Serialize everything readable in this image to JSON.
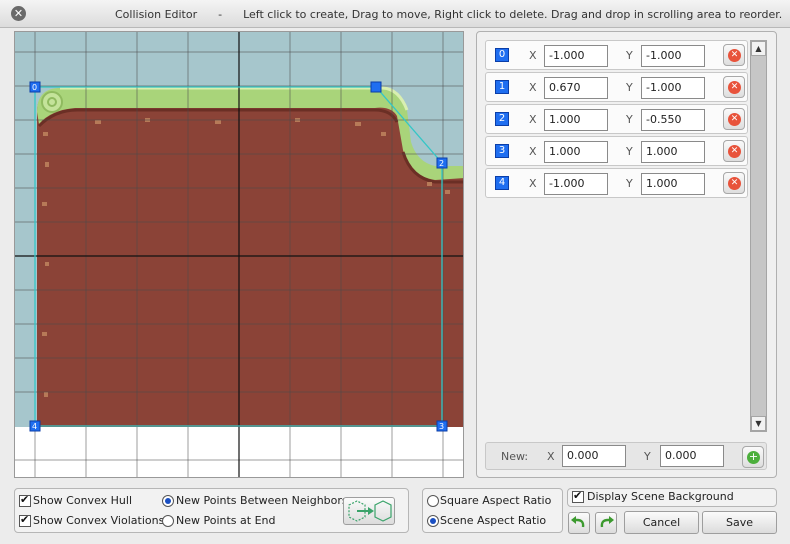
{
  "window": {
    "title": "Collision Editor",
    "separator": "-",
    "instructions": "Left click to create, Drag to move, Right click to delete. Drag and drop in scrolling area to reorder.",
    "close_icon": "close-icon"
  },
  "points": [
    {
      "index": "0",
      "x_label": "X",
      "x": "-1.000",
      "y_label": "Y",
      "y": "-1.000"
    },
    {
      "index": "1",
      "x_label": "X",
      "x": "0.670",
      "y_label": "Y",
      "y": "-1.000"
    },
    {
      "index": "2",
      "x_label": "X",
      "x": "1.000",
      "y_label": "Y",
      "y": "-0.550"
    },
    {
      "index": "3",
      "x_label": "X",
      "x": "1.000",
      "y_label": "Y",
      "y": "1.000"
    },
    {
      "index": "4",
      "x_label": "X",
      "x": "-1.000",
      "y_label": "Y",
      "y": "1.000"
    }
  ],
  "canvas_markers": [
    "0",
    "2",
    "3",
    "4"
  ],
  "new_point": {
    "label": "New:",
    "x_label": "X",
    "x": "0.000",
    "y_label": "Y",
    "y": "0.000"
  },
  "options": {
    "show_convex_hull": {
      "label": "Show Convex Hull",
      "checked": true
    },
    "show_convex_violations": {
      "label": "Show Convex Violations",
      "checked": true
    },
    "new_points_between_neighbors": {
      "label": "New Points Between Neighbors",
      "selected": true
    },
    "new_points_at_end": {
      "label": "New Points at End",
      "selected": false
    },
    "square_aspect_ratio": {
      "label": "Square Aspect Ratio",
      "selected": false
    },
    "scene_aspect_ratio": {
      "label": "Scene Aspect Ratio",
      "selected": true
    },
    "display_scene_background": {
      "label": "Display Scene Background",
      "checked": true
    }
  },
  "buttons": {
    "cancel": "Cancel",
    "save": "Save"
  },
  "colors": {
    "accent_blue": "#1f6ef0",
    "ground": "#8b4337",
    "grass": "#a9d47a",
    "sky": "#a6c6cc",
    "delete_red": "#e8533b",
    "add_green": "#4caf3c"
  }
}
